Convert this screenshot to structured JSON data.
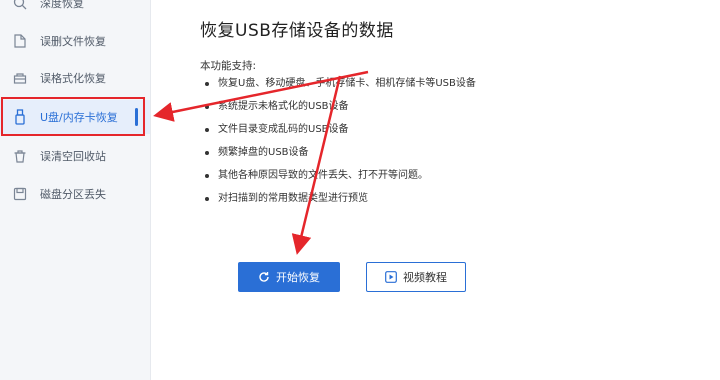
{
  "sidebar": {
    "items": [
      {
        "label": "深度恢复",
        "icon": "deep-scan-icon"
      },
      {
        "label": "误删文件恢复",
        "icon": "file-icon"
      },
      {
        "label": "误格式化恢复",
        "icon": "format-icon"
      },
      {
        "label": "U盘/内存卡恢复",
        "icon": "usb-icon",
        "active": true
      },
      {
        "label": "误清空回收站",
        "icon": "recycle-bin-icon"
      },
      {
        "label": "磁盘分区丢失",
        "icon": "disk-partition-icon"
      }
    ]
  },
  "main": {
    "title": "恢复USB存储设备的数据",
    "support_label": "本功能支持:",
    "features": [
      "恢复U盘、移动硬盘、手机存储卡、相机存储卡等USB设备",
      "系统提示未格式化的USB设备",
      "文件目录变成乱码的USB设备",
      "频繁掉盘的USB设备",
      "其他各种原因导致的文件丢失、打不开等问题。",
      "对扫描到的常用数据类型进行预览"
    ],
    "start_button": "开始恢复",
    "video_button": "视频教程"
  },
  "colors": {
    "accent": "#2a6fd6",
    "annotation": "#e5262b",
    "sidebar_bg": "#f4f6f9"
  }
}
